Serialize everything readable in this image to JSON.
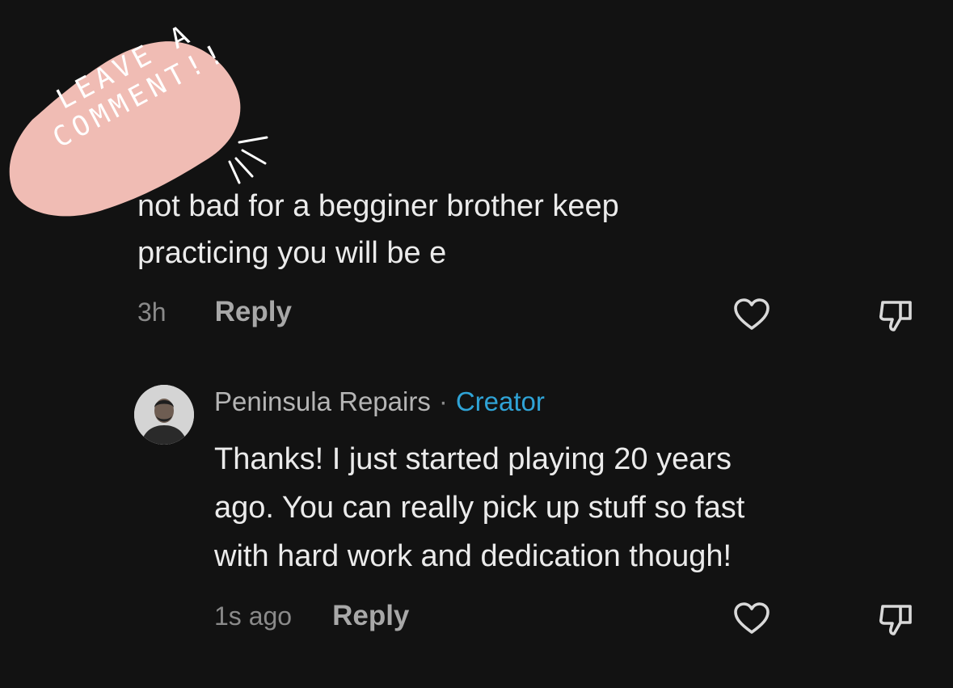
{
  "sticker": {
    "line1": "LEAVE A",
    "line2": "COMMENT!!",
    "color": "#f0bcb4"
  },
  "comment": {
    "text_line1": "not bad for a begginer brother keep",
    "text_line2": "practicing you will be e",
    "time": "3h",
    "reply_label": "Reply",
    "like_icon": "heart-icon",
    "dislike_icon": "thumbs-down-icon"
  },
  "reply": {
    "author": "Peninsula Repairs",
    "separator": "·",
    "badge": "Creator",
    "badge_color": "#2fa3d6",
    "text_line1": "Thanks! I just started playing 20 years",
    "text_line2": "ago. You can really pick up stuff so fast",
    "text_line3": "with hard work and dedication though!",
    "time": "1s ago",
    "reply_label": "Reply",
    "like_icon": "heart-icon",
    "dislike_icon": "thumbs-down-icon"
  }
}
